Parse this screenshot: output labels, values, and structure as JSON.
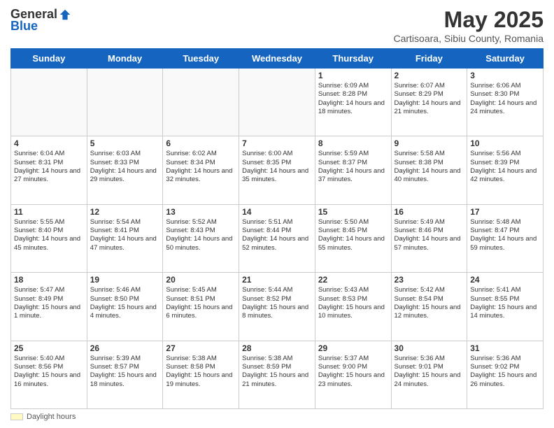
{
  "header": {
    "logo_general": "General",
    "logo_blue": "Blue",
    "month_title": "May 2025",
    "subtitle": "Cartisoara, Sibiu County, Romania"
  },
  "days_of_week": [
    "Sunday",
    "Monday",
    "Tuesday",
    "Wednesday",
    "Thursday",
    "Friday",
    "Saturday"
  ],
  "footer": {
    "daylight_label": "Daylight hours"
  },
  "weeks": [
    [
      {
        "day": "",
        "info": ""
      },
      {
        "day": "",
        "info": ""
      },
      {
        "day": "",
        "info": ""
      },
      {
        "day": "",
        "info": ""
      },
      {
        "day": "1",
        "info": "Sunrise: 6:09 AM\nSunset: 8:28 PM\nDaylight: 14 hours and 18 minutes."
      },
      {
        "day": "2",
        "info": "Sunrise: 6:07 AM\nSunset: 8:29 PM\nDaylight: 14 hours and 21 minutes."
      },
      {
        "day": "3",
        "info": "Sunrise: 6:06 AM\nSunset: 8:30 PM\nDaylight: 14 hours and 24 minutes."
      }
    ],
    [
      {
        "day": "4",
        "info": "Sunrise: 6:04 AM\nSunset: 8:31 PM\nDaylight: 14 hours and 27 minutes."
      },
      {
        "day": "5",
        "info": "Sunrise: 6:03 AM\nSunset: 8:33 PM\nDaylight: 14 hours and 29 minutes."
      },
      {
        "day": "6",
        "info": "Sunrise: 6:02 AM\nSunset: 8:34 PM\nDaylight: 14 hours and 32 minutes."
      },
      {
        "day": "7",
        "info": "Sunrise: 6:00 AM\nSunset: 8:35 PM\nDaylight: 14 hours and 35 minutes."
      },
      {
        "day": "8",
        "info": "Sunrise: 5:59 AM\nSunset: 8:37 PM\nDaylight: 14 hours and 37 minutes."
      },
      {
        "day": "9",
        "info": "Sunrise: 5:58 AM\nSunset: 8:38 PM\nDaylight: 14 hours and 40 minutes."
      },
      {
        "day": "10",
        "info": "Sunrise: 5:56 AM\nSunset: 8:39 PM\nDaylight: 14 hours and 42 minutes."
      }
    ],
    [
      {
        "day": "11",
        "info": "Sunrise: 5:55 AM\nSunset: 8:40 PM\nDaylight: 14 hours and 45 minutes."
      },
      {
        "day": "12",
        "info": "Sunrise: 5:54 AM\nSunset: 8:41 PM\nDaylight: 14 hours and 47 minutes."
      },
      {
        "day": "13",
        "info": "Sunrise: 5:52 AM\nSunset: 8:43 PM\nDaylight: 14 hours and 50 minutes."
      },
      {
        "day": "14",
        "info": "Sunrise: 5:51 AM\nSunset: 8:44 PM\nDaylight: 14 hours and 52 minutes."
      },
      {
        "day": "15",
        "info": "Sunrise: 5:50 AM\nSunset: 8:45 PM\nDaylight: 14 hours and 55 minutes."
      },
      {
        "day": "16",
        "info": "Sunrise: 5:49 AM\nSunset: 8:46 PM\nDaylight: 14 hours and 57 minutes."
      },
      {
        "day": "17",
        "info": "Sunrise: 5:48 AM\nSunset: 8:47 PM\nDaylight: 14 hours and 59 minutes."
      }
    ],
    [
      {
        "day": "18",
        "info": "Sunrise: 5:47 AM\nSunset: 8:49 PM\nDaylight: 15 hours and 1 minute."
      },
      {
        "day": "19",
        "info": "Sunrise: 5:46 AM\nSunset: 8:50 PM\nDaylight: 15 hours and 4 minutes."
      },
      {
        "day": "20",
        "info": "Sunrise: 5:45 AM\nSunset: 8:51 PM\nDaylight: 15 hours and 6 minutes."
      },
      {
        "day": "21",
        "info": "Sunrise: 5:44 AM\nSunset: 8:52 PM\nDaylight: 15 hours and 8 minutes."
      },
      {
        "day": "22",
        "info": "Sunrise: 5:43 AM\nSunset: 8:53 PM\nDaylight: 15 hours and 10 minutes."
      },
      {
        "day": "23",
        "info": "Sunrise: 5:42 AM\nSunset: 8:54 PM\nDaylight: 15 hours and 12 minutes."
      },
      {
        "day": "24",
        "info": "Sunrise: 5:41 AM\nSunset: 8:55 PM\nDaylight: 15 hours and 14 minutes."
      }
    ],
    [
      {
        "day": "25",
        "info": "Sunrise: 5:40 AM\nSunset: 8:56 PM\nDaylight: 15 hours and 16 minutes."
      },
      {
        "day": "26",
        "info": "Sunrise: 5:39 AM\nSunset: 8:57 PM\nDaylight: 15 hours and 18 minutes."
      },
      {
        "day": "27",
        "info": "Sunrise: 5:38 AM\nSunset: 8:58 PM\nDaylight: 15 hours and 19 minutes."
      },
      {
        "day": "28",
        "info": "Sunrise: 5:38 AM\nSunset: 8:59 PM\nDaylight: 15 hours and 21 minutes."
      },
      {
        "day": "29",
        "info": "Sunrise: 5:37 AM\nSunset: 9:00 PM\nDaylight: 15 hours and 23 minutes."
      },
      {
        "day": "30",
        "info": "Sunrise: 5:36 AM\nSunset: 9:01 PM\nDaylight: 15 hours and 24 minutes."
      },
      {
        "day": "31",
        "info": "Sunrise: 5:36 AM\nSunset: 9:02 PM\nDaylight: 15 hours and 26 minutes."
      }
    ]
  ]
}
